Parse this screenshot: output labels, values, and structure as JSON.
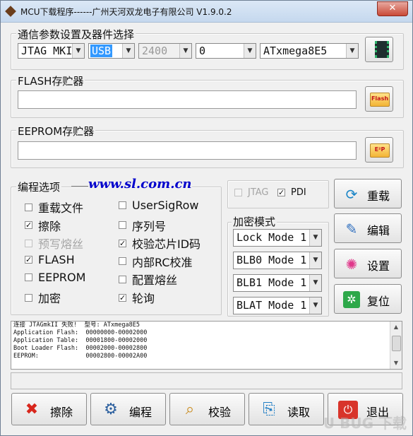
{
  "window": {
    "title": "MCU下载程序------广州天河双龙电子有限公司 V1.9.0.2",
    "close_label": "✕"
  },
  "comm_group": {
    "legend": "通信参数设置及器件选择",
    "programmer": "JTAG MKII",
    "port": "USB",
    "baud": "2400",
    "address": "0",
    "device": "ATxmega8E5"
  },
  "flash_group": {
    "legend": "FLASH存贮器",
    "path": "",
    "button_text": "Flash"
  },
  "eeprom_group": {
    "legend": "EEPROM存贮器",
    "path": "",
    "button_text": "E²P"
  },
  "options": {
    "legend": "编程选项",
    "website": "www.sl.com.cn",
    "left": [
      {
        "label": "重载文件",
        "checked": false,
        "disabled": false
      },
      {
        "label": "擦除",
        "checked": true,
        "disabled": false
      },
      {
        "label": "预写熔丝",
        "checked": false,
        "disabled": true
      },
      {
        "label": "FLASH",
        "checked": true,
        "disabled": false
      },
      {
        "label": "EEPROM",
        "checked": false,
        "disabled": false
      },
      {
        "label": "加密",
        "checked": false,
        "disabled": false
      }
    ],
    "right": [
      {
        "label": "UserSigRow",
        "checked": false,
        "disabled": false
      },
      {
        "label": "序列号",
        "checked": false,
        "disabled": false
      },
      {
        "label": "校验芯片ID码",
        "checked": true,
        "disabled": false
      },
      {
        "label": "内部RC校准",
        "checked": false,
        "disabled": false
      },
      {
        "label": "配置熔丝",
        "checked": false,
        "disabled": false
      },
      {
        "label": "轮询",
        "checked": true,
        "disabled": false
      }
    ]
  },
  "interface": {
    "jtag": {
      "label": "JTAG",
      "checked": false
    },
    "pdi": {
      "label": "PDI",
      "checked": true
    }
  },
  "encrypt": {
    "legend": "加密模式",
    "modes": [
      "Lock Mode 1",
      "BLB0 Mode 1",
      "BLB1 Mode 1",
      "BLAT Mode 1"
    ]
  },
  "side_buttons": {
    "reload": {
      "label": "重载",
      "icon": "refresh-icon"
    },
    "edit": {
      "label": "编辑",
      "icon": "edit-icon"
    },
    "settings": {
      "label": "设置",
      "icon": "spark-icon"
    },
    "reset": {
      "label": "复位",
      "icon": "reset-icon"
    }
  },
  "log": {
    "lines": [
      "连接 JTAGmkII 失败!  型号: ATxmega8E5",
      "Application Flash:  00000000-00002000",
      "Application Table:  00001800-00002000",
      "Boot Loader Flash:  00002000-00002800",
      "EEPROM:             00002800-00002A00"
    ]
  },
  "status": {
    "text": ""
  },
  "bottom_buttons": {
    "erase": {
      "label": "擦除",
      "icon": "x-icon"
    },
    "program": {
      "label": "编程",
      "icon": "gear-icon"
    },
    "verify": {
      "label": "校验",
      "icon": "magnifier-icon"
    },
    "read": {
      "label": "读取",
      "icon": "read-icon"
    },
    "exit": {
      "label": "退出",
      "icon": "power-icon"
    }
  },
  "watermark": "U  BUG 下载",
  "colors": {
    "website": "#0000cc",
    "selection": "#3399ff",
    "title_bar": "#c5d8ee"
  }
}
